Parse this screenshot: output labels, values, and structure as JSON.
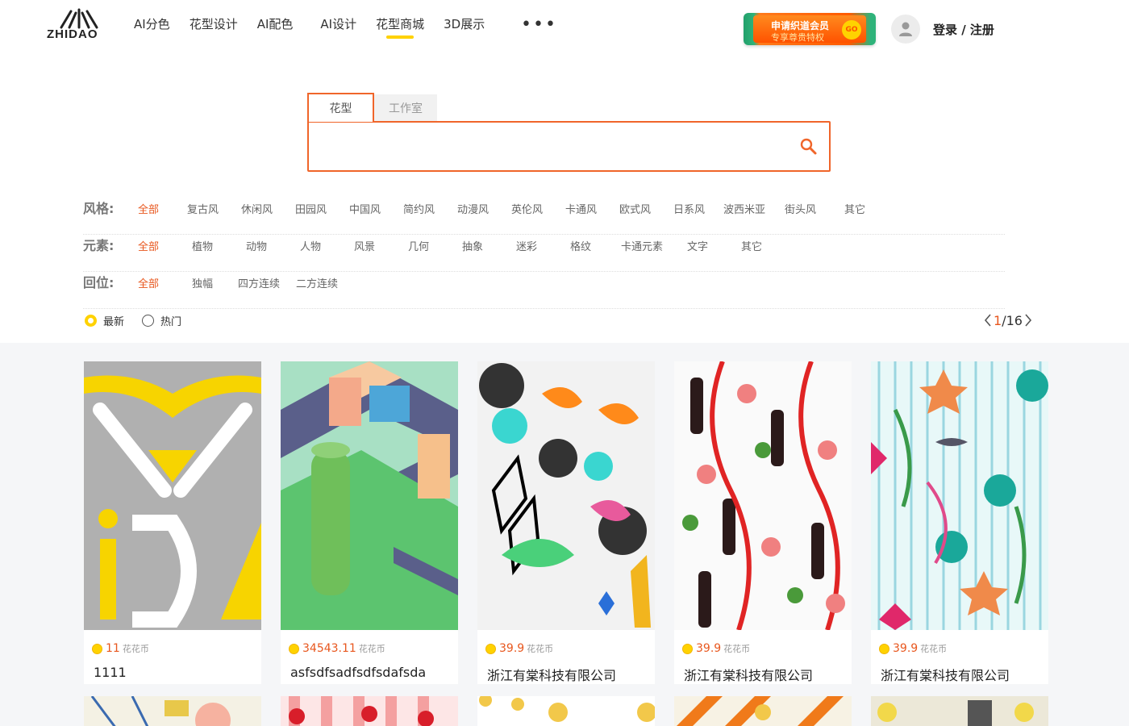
{
  "header": {
    "logo_text": "ZHIDAO",
    "nav": [
      {
        "label": "AI分色",
        "active": false
      },
      {
        "label": "花型设计",
        "active": false
      },
      {
        "label": "AI配色",
        "active": false
      },
      {
        "label": "AI设计",
        "active": false
      },
      {
        "label": "花型商城",
        "active": true
      },
      {
        "label": "3D展示",
        "active": false
      }
    ],
    "more": "•••",
    "vip": {
      "line1": "申请织道会员",
      "line2": "专享尊贵特权",
      "go": "GO"
    },
    "login_label": "登录 / 注册"
  },
  "search": {
    "tabs": [
      "花型",
      "工作室"
    ],
    "active_tab": 0,
    "value": "",
    "placeholder": ""
  },
  "filters": [
    {
      "label": "风格:",
      "options": [
        "全部",
        "复古风",
        "休闲风",
        "田园风",
        "中国风",
        "简约风",
        "动漫风",
        "英伦风",
        "卡通风",
        "欧式风",
        "日系风",
        "波西米亚",
        "街头风",
        "其它"
      ]
    },
    {
      "label": "元素:",
      "options": [
        "全部",
        "植物",
        "动物",
        "人物",
        "风景",
        "几何",
        "抽象",
        "迷彩",
        "格纹",
        "卡通元素",
        "文字",
        "其它"
      ]
    },
    {
      "label": "回位:",
      "options": [
        "全部",
        "独幅",
        "四方连续",
        "二方连续"
      ]
    }
  ],
  "sort": {
    "options": [
      "最新",
      "热门"
    ],
    "selected": 0
  },
  "pager": {
    "current": "1",
    "total": "/16"
  },
  "colors": {
    "accent": "#e8571e",
    "yellow": "#ffd200"
  },
  "products": [
    {
      "price": "11",
      "unit": "花花币",
      "name": "1111"
    },
    {
      "price": "34543.11",
      "unit": "花花币",
      "name": "asfsdfsadfsdfsdafsda"
    },
    {
      "price": "39.9",
      "unit": "花花币",
      "name": "浙江有棠科技有限公司"
    },
    {
      "price": "39.9",
      "unit": "花花币",
      "name": "浙江有棠科技有限公司"
    },
    {
      "price": "39.9",
      "unit": "花花币",
      "name": "浙江有棠科技有限公司"
    }
  ]
}
